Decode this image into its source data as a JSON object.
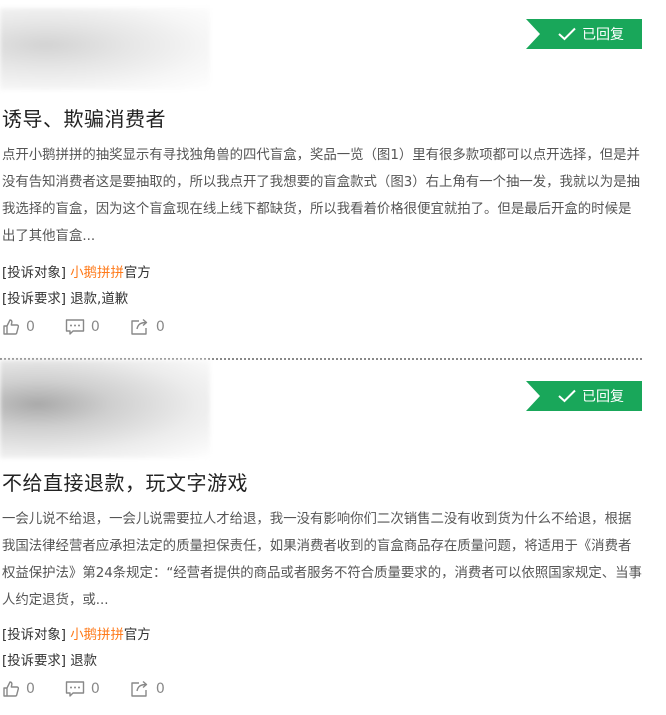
{
  "complaints": [
    {
      "status": "已回复",
      "title": "诱导、欺骗消费者",
      "description": "点开小鹅拼拼的抽奖显示有寻找独角兽的四代盲盒，奖品一览（图1）里有很多款项都可以点开选择，但是并没有告知消费者这是要抽取的，所以我点开了我想要的盲盒款式（图3）右上角有一个抽一发，我就以为是抽我选择的盲盒，因为这个盲盒现在线上线下都缺货，所以我看着价格很便宜就拍了。但是最后开盒的时候是出了其他盲盒...",
      "target_label": "[投诉对象]",
      "target_brand": "小鹅拼拼",
      "target_suffix": "官方",
      "demand_label": "[投诉要求]",
      "demand_value": "退款,道歉",
      "likes": "0",
      "comments": "0",
      "shares": "0"
    },
    {
      "status": "已回复",
      "title": "不给直接退款，玩文字游戏",
      "description": "一会儿说不给退，一会儿说需要拉人才给退，我一没有影响你们二次销售二没有收到货为什么不给退，根据我国法律经营者应承担法定的质量担保责任，如果消费者收到的盲盒商品存在质量问题，将适用于《消费者权益保护法》第24条规定：“经营者提供的商品或者服务不符合质量要求的，消费者可以依照国家规定、当事人约定退货，或...",
      "target_label": "[投诉对象]",
      "target_brand": "小鹅拼拼",
      "target_suffix": "官方",
      "demand_label": "[投诉要求]",
      "demand_value": "退款",
      "likes": "0",
      "comments": "0",
      "shares": "0"
    }
  ],
  "colors": {
    "badge": "#19a75a",
    "brand": "#ff7a1a"
  },
  "icons": [
    "check-icon",
    "thumbs-up-icon",
    "comment-icon",
    "share-icon"
  ]
}
